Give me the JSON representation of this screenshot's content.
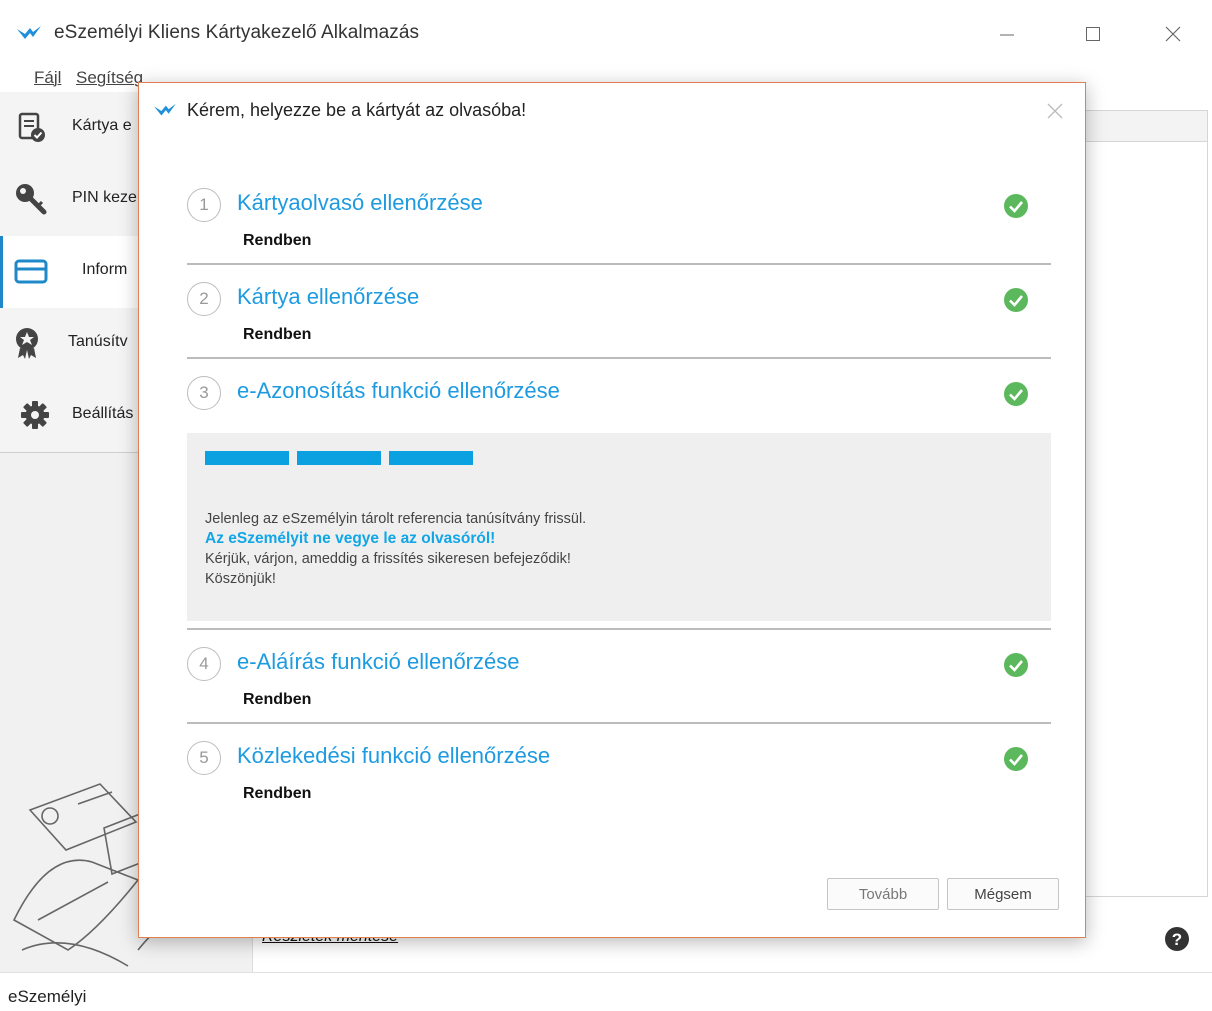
{
  "window": {
    "title": "eSzemélyi Kliens Kártyakezelő Alkalmazás",
    "menu": [
      "Fájl",
      "Segítség"
    ]
  },
  "sidebar": {
    "items": [
      {
        "label": "Kártya e",
        "icon": "card-check-icon"
      },
      {
        "label": "PIN keze",
        "icon": "key-icon"
      },
      {
        "label": "Inform",
        "icon": "card-icon"
      },
      {
        "label": "Tanúsítv",
        "icon": "certificate-badge-icon"
      },
      {
        "label": "Beállítás",
        "icon": "gear-icon"
      }
    ]
  },
  "main": {
    "details_link": "Részletek mentése"
  },
  "status": {
    "text": "eSzemélyi"
  },
  "dialog": {
    "title": "Kérem, helyezze be a kártyát az olvasóba!",
    "steps": [
      {
        "num": "1",
        "title": "Kártyaolvasó ellenőrzése",
        "status": "Rendben"
      },
      {
        "num": "2",
        "title": "Kártya ellenőrzése",
        "status": "Rendben"
      },
      {
        "num": "3",
        "title": "e-Azonosítás funkció ellenőrzése",
        "status": ""
      },
      {
        "num": "4",
        "title": "e-Aláírás funkció ellenőrzése",
        "status": "Rendben"
      },
      {
        "num": "5",
        "title": "Közlekedési funkció ellenőrzése",
        "status": "Rendben"
      }
    ],
    "progress": {
      "segments_filled": 3,
      "line1": "Jelenleg az eSzemélyin tárolt referencia tanúsítvány frissül.",
      "warning": "Az eSzemélyit ne vegye le az olvasóról!",
      "line2": "Kérjük, várjon, ameddig a frissítés sikeresen befejeződik!",
      "line3": "Köszönjük!"
    },
    "buttons": {
      "next": "Tovább",
      "cancel": "Mégsem"
    }
  },
  "colors": {
    "accent": "#1e9be0",
    "progress": "#0ba0e0",
    "success": "#5cb85c",
    "dialog_border": "#e08050"
  }
}
